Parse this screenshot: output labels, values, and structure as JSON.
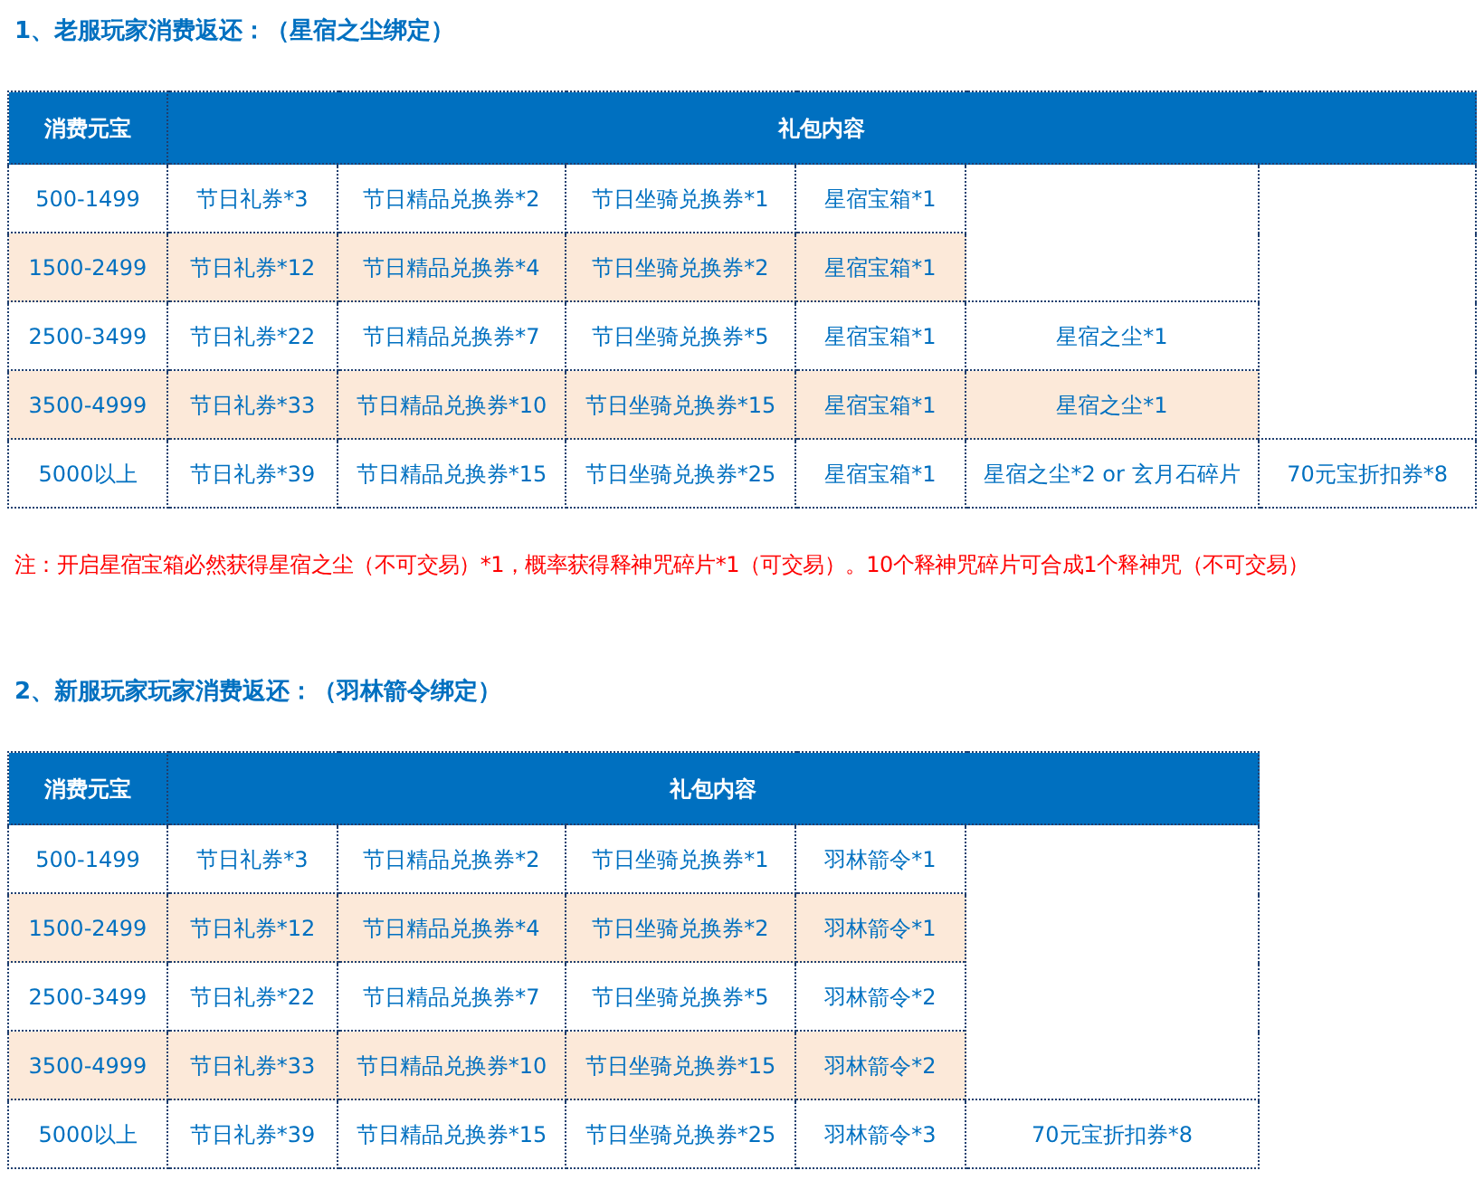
{
  "sections": [
    {
      "heading": "1、老服玩家消费返还：（星宿之尘绑定）",
      "table": {
        "columns": [
          {
            "label": "消费元宝"
          },
          {
            "label": "礼包内容",
            "colspan": 6
          }
        ],
        "rows": [
          {
            "highlighted": false,
            "cells": [
              "500-1499",
              "节日礼券*3",
              "节日精品兑换券*2",
              "节日坐骑兑换券*1",
              "星宿宝箱*1"
            ]
          },
          {
            "highlighted": true,
            "cells": [
              "1500-2499",
              "节日礼券*12",
              "节日精品兑换券*4",
              "节日坐骑兑换券*2",
              "星宿宝箱*1"
            ]
          },
          {
            "highlighted": false,
            "cells": [
              "2500-3499",
              "节日礼券*22",
              "节日精品兑换券*7",
              "节日坐骑兑换券*5",
              "星宿宝箱*1",
              "星宿之尘*1"
            ]
          },
          {
            "highlighted": true,
            "cells": [
              "3500-4999",
              "节日礼券*33",
              "节日精品兑换券*10",
              "节日坐骑兑换券*15",
              "星宿宝箱*1",
              "星宿之尘*1"
            ]
          },
          {
            "highlighted": false,
            "cells": [
              "5000以上",
              "节日礼券*39",
              "节日精品兑换券*15",
              "节日坐骑兑换券*25",
              "星宿宝箱*1",
              "星宿之尘*2 or 玄月石碎片",
              "70元宝折扣券*8"
            ]
          }
        ]
      },
      "note": "注：开启星宿宝箱必然获得星宿之尘（不可交易）*1，概率获得释神咒碎片*1（可交易）。10个释神咒碎片可合成1个释神咒（不可交易）"
    },
    {
      "heading": "2、新服玩家玩家消费返还：（羽林箭令绑定）",
      "table": {
        "columns": [
          {
            "label": "消费元宝"
          },
          {
            "label": "礼包内容",
            "colspan": 5
          }
        ],
        "rows": [
          {
            "highlighted": false,
            "cells": [
              "500-1499",
              "节日礼券*3",
              "节日精品兑换券*2",
              "节日坐骑兑换券*1",
              "羽林箭令*1"
            ]
          },
          {
            "highlighted": true,
            "cells": [
              "1500-2499",
              "节日礼券*12",
              "节日精品兑换券*4",
              "节日坐骑兑换券*2",
              "羽林箭令*1"
            ]
          },
          {
            "highlighted": false,
            "cells": [
              "2500-3499",
              "节日礼券*22",
              "节日精品兑换券*7",
              "节日坐骑兑换券*5",
              "羽林箭令*2"
            ]
          },
          {
            "highlighted": true,
            "cells": [
              "3500-4999",
              "节日礼券*33",
              "节日精品兑换券*10",
              "节日坐骑兑换券*15",
              "羽林箭令*2"
            ]
          },
          {
            "highlighted": false,
            "cells": [
              "5000以上",
              "节日礼券*39",
              "节日精品兑换券*15",
              "节日坐骑兑换券*25",
              "羽林箭令*3",
              "70元宝折扣券*8"
            ]
          }
        ]
      }
    }
  ]
}
